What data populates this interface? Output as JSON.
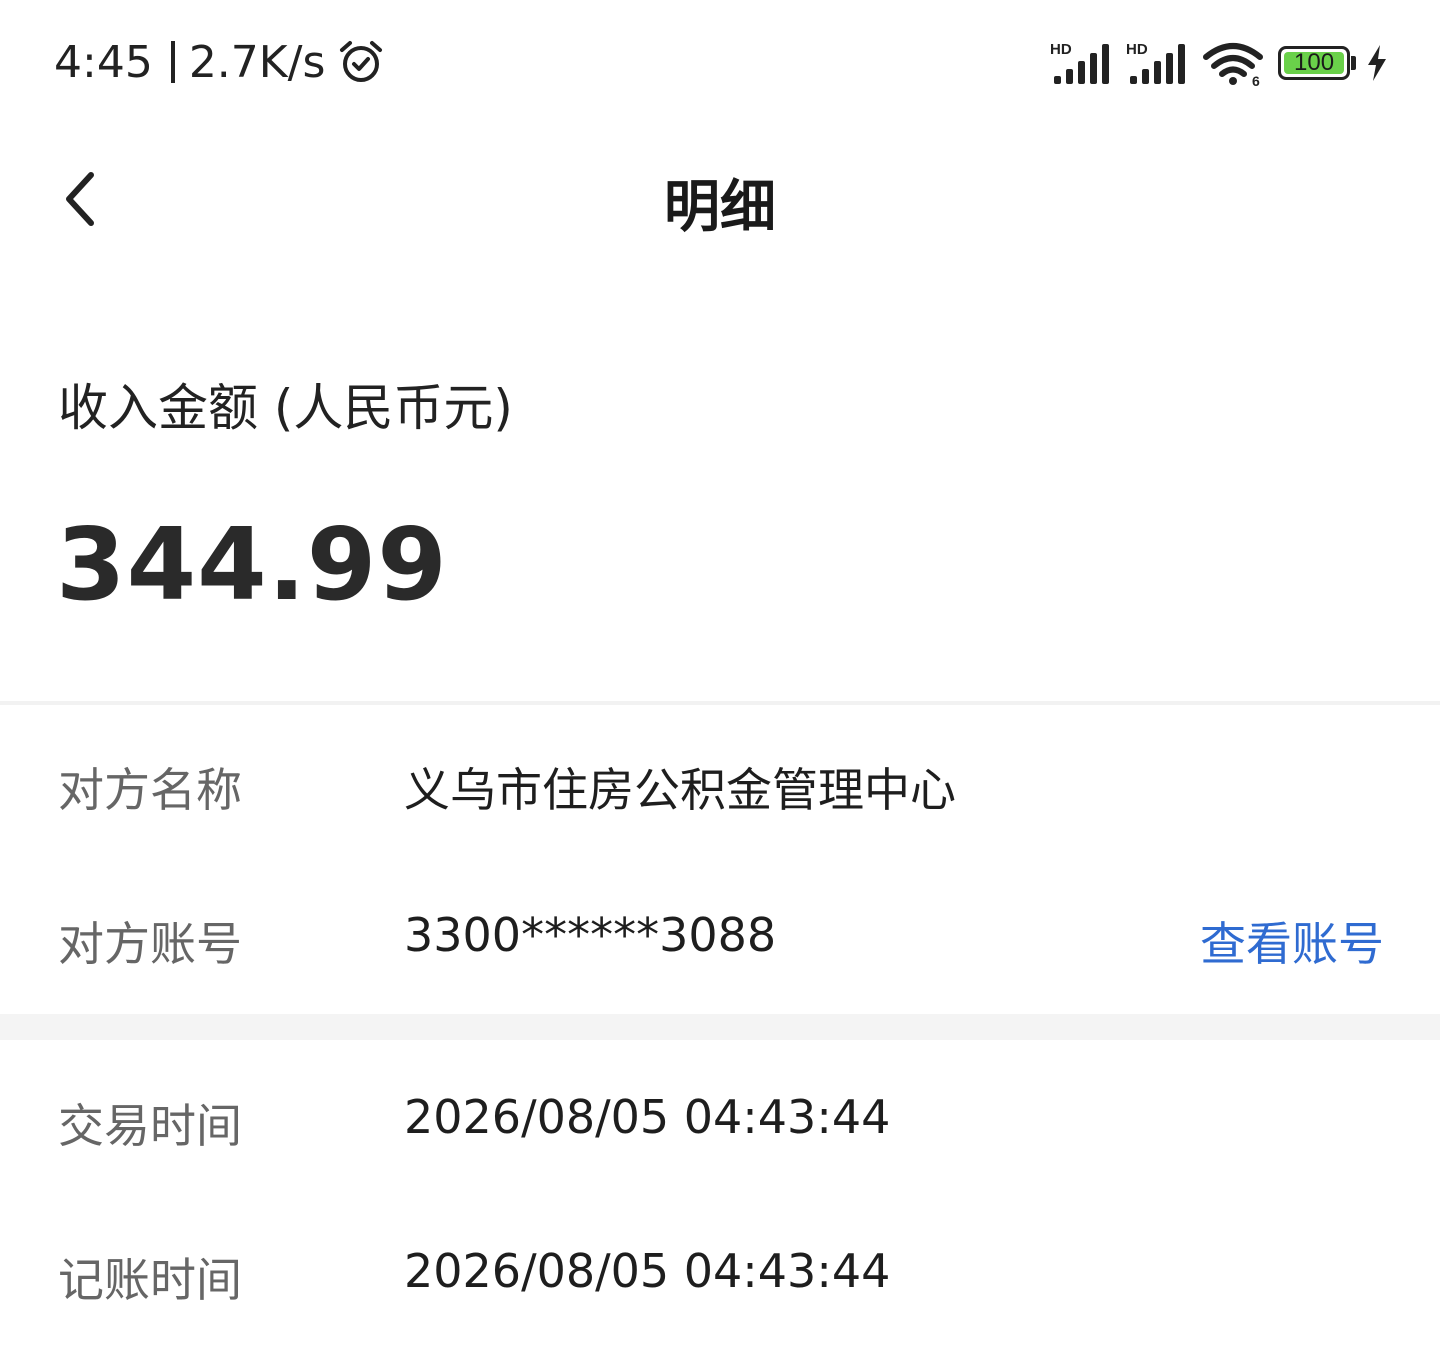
{
  "status_bar": {
    "time": "4:45",
    "speed": "2.7K/s",
    "battery": "100",
    "signal_1_label": "HD",
    "signal_2_label": "HD",
    "wifi_label": "6",
    "icons": [
      "alarm-icon",
      "signal-icon",
      "signal-icon",
      "wifi-icon",
      "battery-icon",
      "charging-bolt-icon"
    ]
  },
  "nav": {
    "title": "明细",
    "back_icon": "chevron-left-icon"
  },
  "amount": {
    "label": "收入金额 (人民币元)",
    "value": "344.99"
  },
  "details": {
    "counterparty_name_label": "对方名称",
    "counterparty_name": "义乌市住房公积金管理中心",
    "counterparty_account_label": "对方账号",
    "counterparty_account": "3300******3088",
    "view_account_label": "查看账号",
    "transaction_time_label": "交易时间",
    "transaction_time": "2026/08/05 04:43:44",
    "posting_time_label": "记账时间",
    "posting_time": "2026/08/05 04:43:44"
  },
  "colors": {
    "link": "#2f6bd1",
    "battery_fill": "#6ad14a",
    "label_gray": "#666666"
  }
}
